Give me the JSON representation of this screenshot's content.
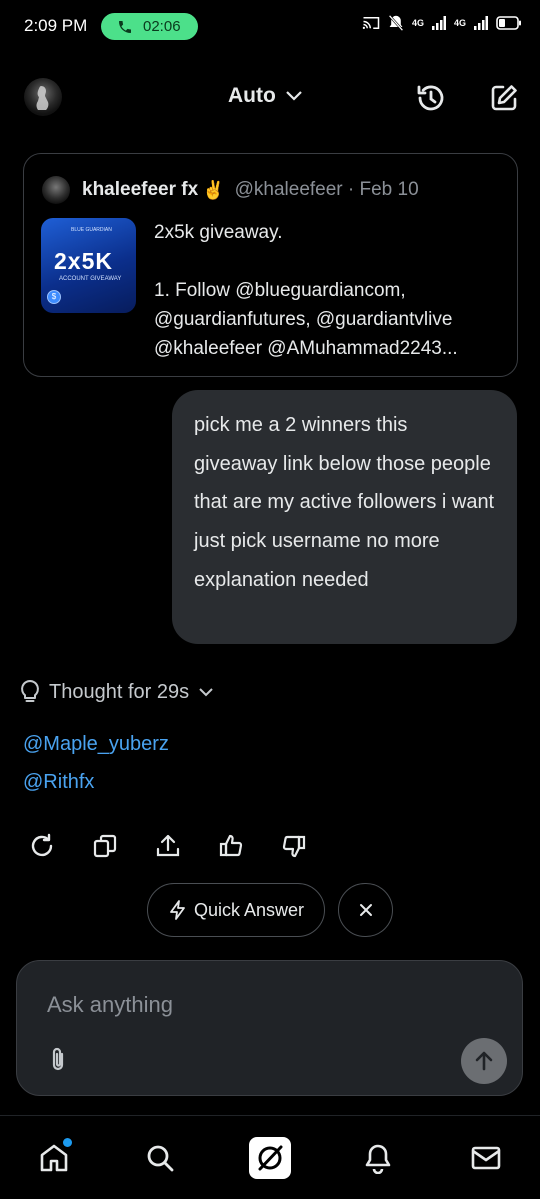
{
  "status_bar": {
    "time": "2:09 PM",
    "call_timer": "02:06",
    "network_1": "4G",
    "network_2": "4G"
  },
  "header": {
    "mode_label": "Auto"
  },
  "quoted_post": {
    "author_name": "khaleefeer fx",
    "emoji": "✌️",
    "handle_date": "@khaleefeer · Feb 10",
    "thumbnail": {
      "brand": "BLUE GUARDIAN",
      "big_text": "2x5K",
      "sub_text": "ACCOUNT GIVEAWAY"
    },
    "lines": [
      "2x5k giveaway.",
      "",
      "1. Follow @blueguardiancom,",
      "@guardianfutures, @guardiantvlive",
      "@khaleefeer @AMuhammad2243..."
    ]
  },
  "user_message": {
    "text": "pick me a 2 winners  this giveaway link below those people that are my active followers i want just pick username no more explanation needed"
  },
  "answer": {
    "thought_label": "Thought for 29s",
    "winners": [
      "@Maple_yuberz",
      "@Rithfx"
    ]
  },
  "chips": {
    "quick_answer": "Quick Answer"
  },
  "composer": {
    "placeholder": "Ask anything"
  },
  "colors": {
    "background": "#000000",
    "link": "#4aa3f0",
    "bubble": "#2a2d31",
    "call_pill": "#4ce08a",
    "notification_dot": "#1d9bf0"
  },
  "icons": [
    "phone-icon",
    "cast-icon",
    "mute-icon",
    "signal-icon",
    "battery-icon",
    "history-icon",
    "compose-icon",
    "chevron-down-icon",
    "lightbulb-icon",
    "regenerate-icon",
    "copy-icon",
    "share-icon",
    "thumbs-up-icon",
    "thumbs-down-icon",
    "bolt-icon",
    "close-icon",
    "attach-icon",
    "send-arrow-icon",
    "home-icon",
    "search-icon",
    "grok-icon",
    "bell-icon",
    "mail-icon"
  ]
}
